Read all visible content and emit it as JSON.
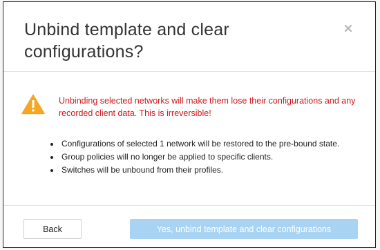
{
  "dialog": {
    "title": "Unbind template and clear configurations?",
    "close_icon": "close-icon",
    "warning": {
      "icon": "warning-triangle-icon",
      "color": "#d0181c",
      "icon_color": "#f5a623",
      "message": "Unbinding selected networks will make them lose their configurations and any recorded client data. This is irreversible!"
    },
    "bullets": [
      "Configurations of selected 1 network will be restored to the pre-bound state.",
      "Group policies will no longer be applied to specific clients.",
      "Switches will be unbound from their profiles."
    ],
    "footer": {
      "back_label": "Back",
      "confirm_label": "Yes, unbind template and clear configurations",
      "confirm_color": "#a9d3f3"
    }
  }
}
